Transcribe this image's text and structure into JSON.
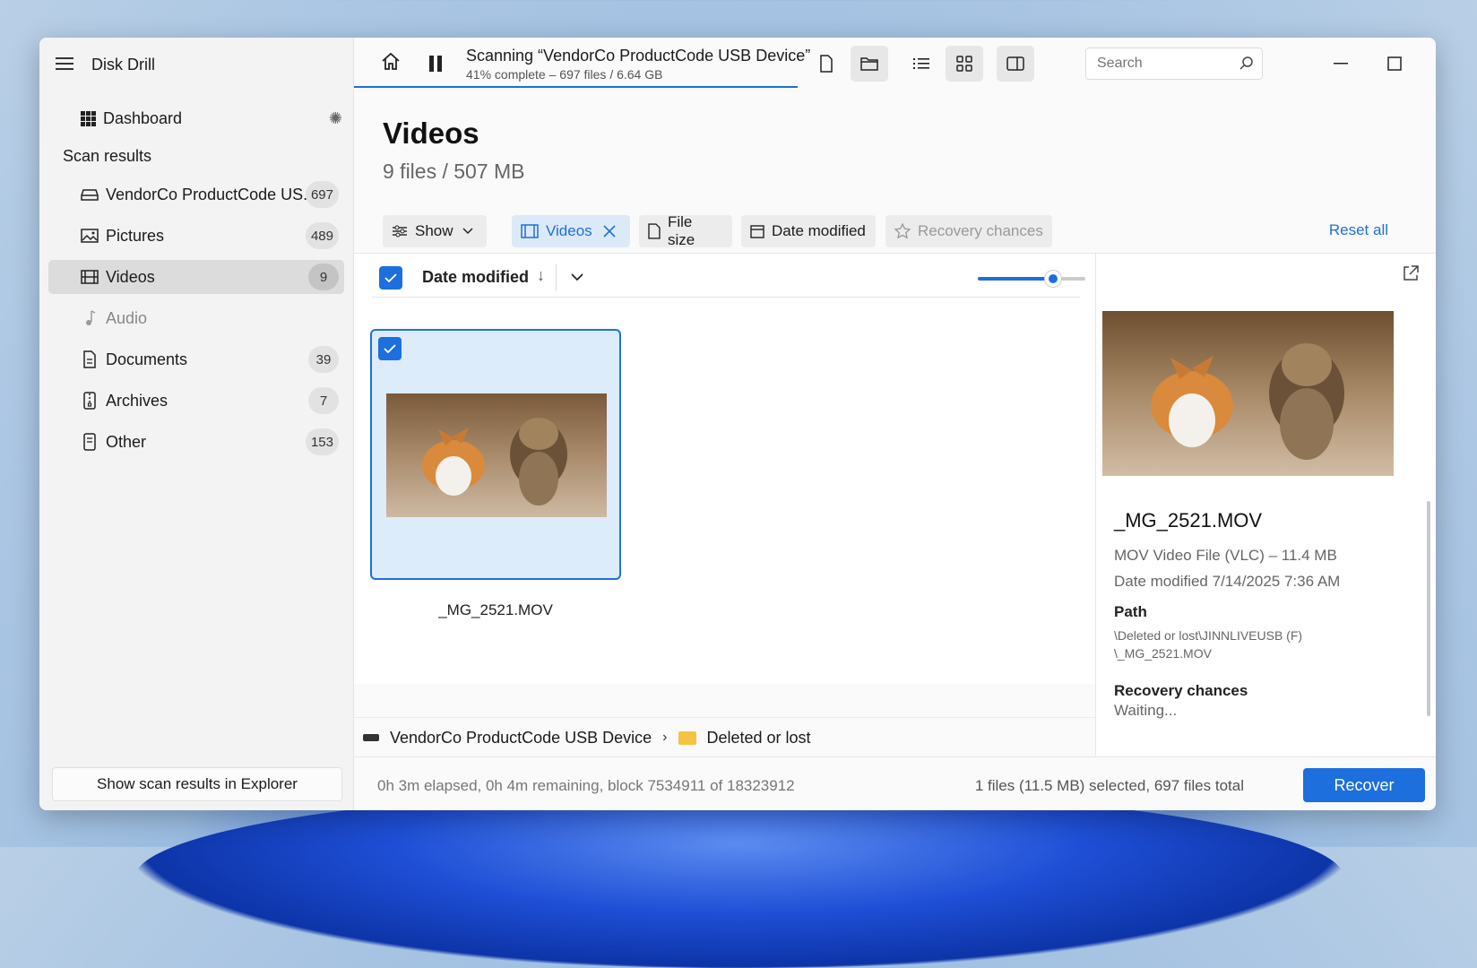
{
  "app": {
    "title": "Disk Drill"
  },
  "sidebar": {
    "dashboard_label": "Dashboard",
    "scan_results_heading": "Scan results",
    "items": [
      {
        "label": "VendorCo ProductCode US...",
        "count": "697",
        "icon": "drive-icon"
      },
      {
        "label": "Pictures",
        "count": "489",
        "icon": "image-icon"
      },
      {
        "label": "Videos",
        "count": "9",
        "icon": "film-icon",
        "active": true
      },
      {
        "label": "Audio",
        "count": "",
        "icon": "music-note-icon",
        "muted": true
      },
      {
        "label": "Documents",
        "count": "39",
        "icon": "document-icon"
      },
      {
        "label": "Archives",
        "count": "7",
        "icon": "archive-icon"
      },
      {
        "label": "Other",
        "count": "153",
        "icon": "file-other-icon"
      }
    ],
    "explorer_button": "Show scan results in Explorer"
  },
  "toolbar": {
    "scan_title": "Scanning “VendorCo ProductCode USB Device”",
    "scan_subtitle": "41% complete – 697 files / 6.64 GB",
    "progress_fraction": 0.41,
    "search_placeholder": "Search"
  },
  "main": {
    "heading": "Videos",
    "subheading": "9 files / 507 MB",
    "filters": {
      "show": "Show",
      "videos": "Videos",
      "file_size": "File size",
      "date_modified": "Date modified",
      "recovery_chances": "Recovery chances",
      "reset_all": "Reset all"
    },
    "sort": {
      "label": "Date modified",
      "arrow": "↓",
      "zoom_level": 0.7
    },
    "files": [
      {
        "name": "_MG_2521.MOV",
        "selected": true
      }
    ],
    "breadcrumb": {
      "device": "VendorCo ProductCode USB Device",
      "folder": "Deleted or lost"
    }
  },
  "preview": {
    "name": "_MG_2521.MOV",
    "type_size": "MOV Video File (VLC) – 11.4 MB",
    "date": "Date modified 7/14/2025 7:36 AM",
    "path_label": "Path",
    "path_line1": "\\Deleted or lost\\JINNLIVEUSB (F)",
    "path_line2": "\\_MG_2521.MOV",
    "recovery_label": "Recovery chances",
    "recovery_value": "Waiting..."
  },
  "status": {
    "elapsed": "0h 3m elapsed, 0h 4m remaining, block 7534911 of 18323912",
    "selected": "1 files (11.5 MB) selected, 697 files total",
    "recover_button": "Recover"
  },
  "colors": {
    "accent": "#1d6fde",
    "sidebar_bg": "#f3f3f3",
    "selection_bg": "#dcecfb"
  }
}
